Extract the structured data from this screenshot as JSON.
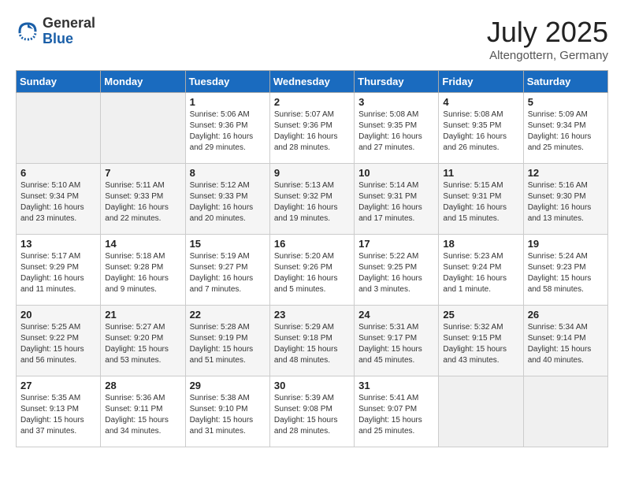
{
  "header": {
    "logo_general": "General",
    "logo_blue": "Blue",
    "month_year": "July 2025",
    "location": "Altengottern, Germany"
  },
  "weekdays": [
    "Sunday",
    "Monday",
    "Tuesday",
    "Wednesday",
    "Thursday",
    "Friday",
    "Saturday"
  ],
  "weeks": [
    [
      {
        "day": "",
        "info": ""
      },
      {
        "day": "",
        "info": ""
      },
      {
        "day": "1",
        "info": "Sunrise: 5:06 AM\nSunset: 9:36 PM\nDaylight: 16 hours and 29 minutes."
      },
      {
        "day": "2",
        "info": "Sunrise: 5:07 AM\nSunset: 9:36 PM\nDaylight: 16 hours and 28 minutes."
      },
      {
        "day": "3",
        "info": "Sunrise: 5:08 AM\nSunset: 9:35 PM\nDaylight: 16 hours and 27 minutes."
      },
      {
        "day": "4",
        "info": "Sunrise: 5:08 AM\nSunset: 9:35 PM\nDaylight: 16 hours and 26 minutes."
      },
      {
        "day": "5",
        "info": "Sunrise: 5:09 AM\nSunset: 9:34 PM\nDaylight: 16 hours and 25 minutes."
      }
    ],
    [
      {
        "day": "6",
        "info": "Sunrise: 5:10 AM\nSunset: 9:34 PM\nDaylight: 16 hours and 23 minutes."
      },
      {
        "day": "7",
        "info": "Sunrise: 5:11 AM\nSunset: 9:33 PM\nDaylight: 16 hours and 22 minutes."
      },
      {
        "day": "8",
        "info": "Sunrise: 5:12 AM\nSunset: 9:33 PM\nDaylight: 16 hours and 20 minutes."
      },
      {
        "day": "9",
        "info": "Sunrise: 5:13 AM\nSunset: 9:32 PM\nDaylight: 16 hours and 19 minutes."
      },
      {
        "day": "10",
        "info": "Sunrise: 5:14 AM\nSunset: 9:31 PM\nDaylight: 16 hours and 17 minutes."
      },
      {
        "day": "11",
        "info": "Sunrise: 5:15 AM\nSunset: 9:31 PM\nDaylight: 16 hours and 15 minutes."
      },
      {
        "day": "12",
        "info": "Sunrise: 5:16 AM\nSunset: 9:30 PM\nDaylight: 16 hours and 13 minutes."
      }
    ],
    [
      {
        "day": "13",
        "info": "Sunrise: 5:17 AM\nSunset: 9:29 PM\nDaylight: 16 hours and 11 minutes."
      },
      {
        "day": "14",
        "info": "Sunrise: 5:18 AM\nSunset: 9:28 PM\nDaylight: 16 hours and 9 minutes."
      },
      {
        "day": "15",
        "info": "Sunrise: 5:19 AM\nSunset: 9:27 PM\nDaylight: 16 hours and 7 minutes."
      },
      {
        "day": "16",
        "info": "Sunrise: 5:20 AM\nSunset: 9:26 PM\nDaylight: 16 hours and 5 minutes."
      },
      {
        "day": "17",
        "info": "Sunrise: 5:22 AM\nSunset: 9:25 PM\nDaylight: 16 hours and 3 minutes."
      },
      {
        "day": "18",
        "info": "Sunrise: 5:23 AM\nSunset: 9:24 PM\nDaylight: 16 hours and 1 minute."
      },
      {
        "day": "19",
        "info": "Sunrise: 5:24 AM\nSunset: 9:23 PM\nDaylight: 15 hours and 58 minutes."
      }
    ],
    [
      {
        "day": "20",
        "info": "Sunrise: 5:25 AM\nSunset: 9:22 PM\nDaylight: 15 hours and 56 minutes."
      },
      {
        "day": "21",
        "info": "Sunrise: 5:27 AM\nSunset: 9:20 PM\nDaylight: 15 hours and 53 minutes."
      },
      {
        "day": "22",
        "info": "Sunrise: 5:28 AM\nSunset: 9:19 PM\nDaylight: 15 hours and 51 minutes."
      },
      {
        "day": "23",
        "info": "Sunrise: 5:29 AM\nSunset: 9:18 PM\nDaylight: 15 hours and 48 minutes."
      },
      {
        "day": "24",
        "info": "Sunrise: 5:31 AM\nSunset: 9:17 PM\nDaylight: 15 hours and 45 minutes."
      },
      {
        "day": "25",
        "info": "Sunrise: 5:32 AM\nSunset: 9:15 PM\nDaylight: 15 hours and 43 minutes."
      },
      {
        "day": "26",
        "info": "Sunrise: 5:34 AM\nSunset: 9:14 PM\nDaylight: 15 hours and 40 minutes."
      }
    ],
    [
      {
        "day": "27",
        "info": "Sunrise: 5:35 AM\nSunset: 9:13 PM\nDaylight: 15 hours and 37 minutes."
      },
      {
        "day": "28",
        "info": "Sunrise: 5:36 AM\nSunset: 9:11 PM\nDaylight: 15 hours and 34 minutes."
      },
      {
        "day": "29",
        "info": "Sunrise: 5:38 AM\nSunset: 9:10 PM\nDaylight: 15 hours and 31 minutes."
      },
      {
        "day": "30",
        "info": "Sunrise: 5:39 AM\nSunset: 9:08 PM\nDaylight: 15 hours and 28 minutes."
      },
      {
        "day": "31",
        "info": "Sunrise: 5:41 AM\nSunset: 9:07 PM\nDaylight: 15 hours and 25 minutes."
      },
      {
        "day": "",
        "info": ""
      },
      {
        "day": "",
        "info": ""
      }
    ]
  ]
}
